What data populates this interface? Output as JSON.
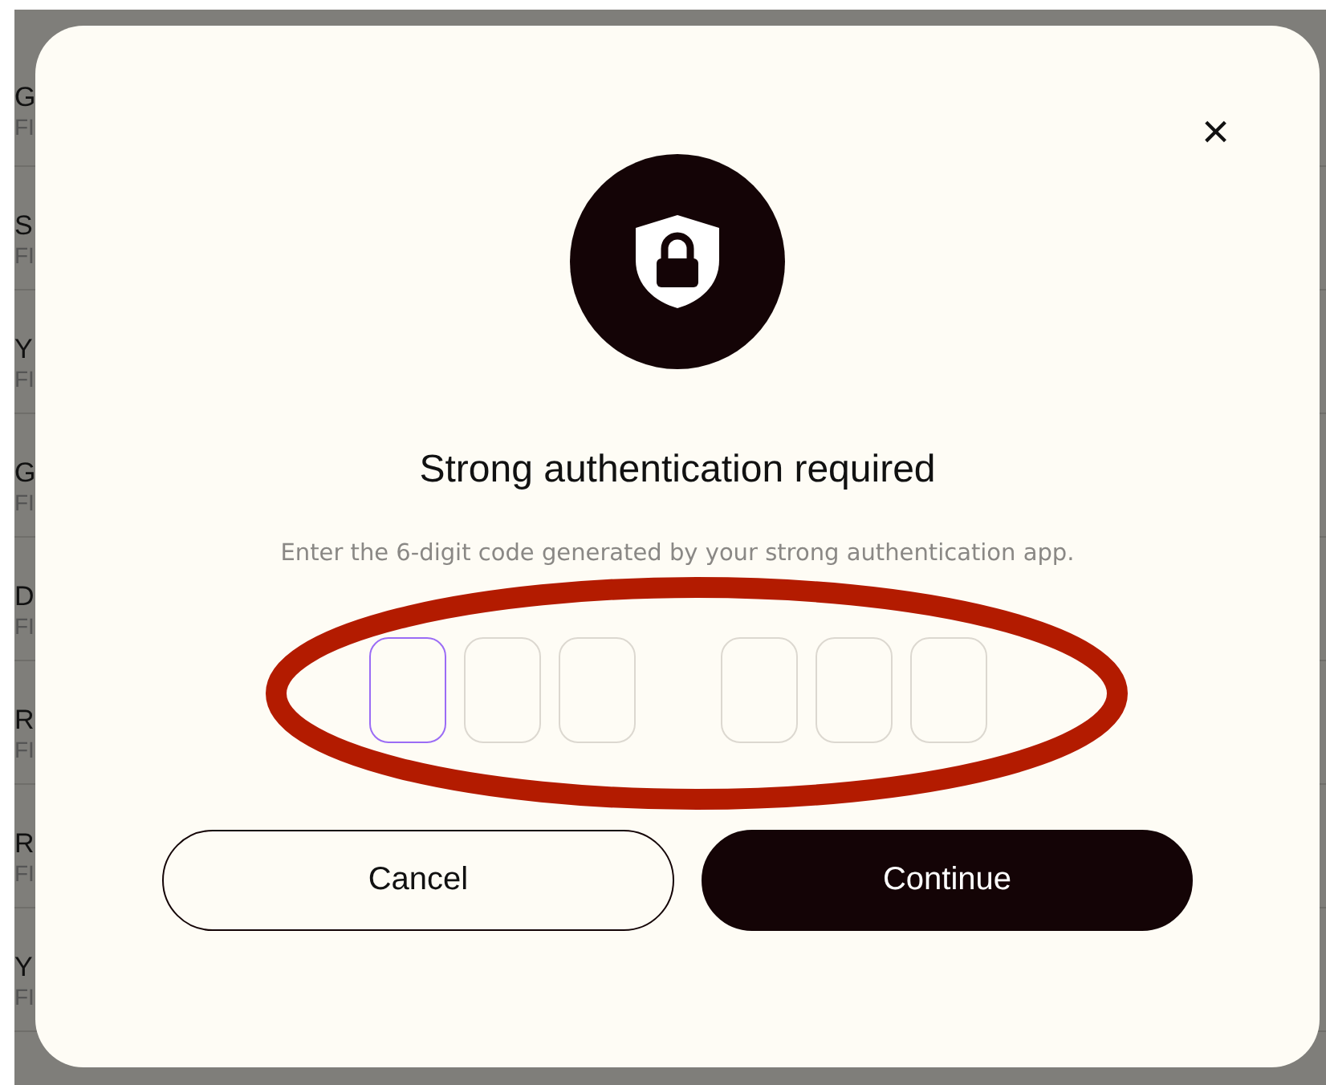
{
  "background_list": [
    {
      "name": "G",
      "detail": "FI"
    },
    {
      "name": "S",
      "detail": "FI"
    },
    {
      "name": "Y",
      "detail": "FI"
    },
    {
      "name": "G",
      "detail": "FI"
    },
    {
      "name": "D",
      "detail": "FI"
    },
    {
      "name": "R",
      "detail": "FI"
    },
    {
      "name": "R",
      "detail": "FI"
    },
    {
      "name": "Y",
      "detail": "FI"
    }
  ],
  "dialog": {
    "close": "×",
    "title": "Strong authentication required",
    "description": "Enter the 6-digit code generated by your strong authentication app.",
    "code_fields": [
      {
        "selected": true
      },
      {
        "selected": false
      },
      {
        "selected": false
      },
      {
        "selected": false
      },
      {
        "selected": false
      },
      {
        "selected": false
      }
    ],
    "buttons": [
      {
        "label": "Cancel",
        "kind": "secondary"
      },
      {
        "label": "Continue",
        "kind": "primary"
      }
    ]
  },
  "annotation": {
    "kind": "ellipse",
    "color": "#b31b00"
  }
}
